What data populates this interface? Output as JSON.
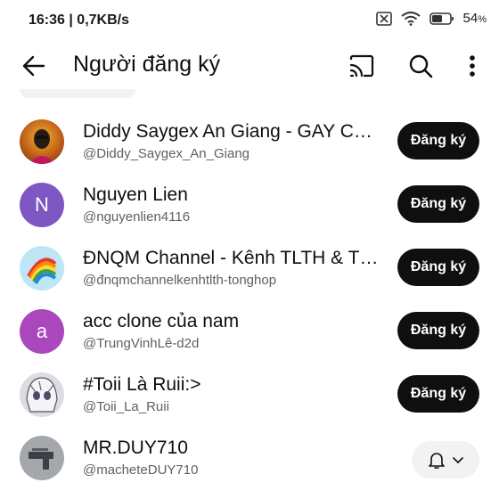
{
  "status_bar": {
    "time": "16:36",
    "speed": "0,7KB/s",
    "battery": "54"
  },
  "header": {
    "title": "Người đăng ký",
    "icons": [
      "back-arrow-icon",
      "cast-icon",
      "search-icon",
      "more-vert-icon"
    ]
  },
  "subscribers": [
    {
      "name": "Diddy Saygex An Giang - GAY Cấp Độ Hỗn Mang",
      "handle": "@Diddy_Saygex_An_Giang",
      "button": "Đăng ký",
      "avatar_color": "#c7751b"
    },
    {
      "name": "Nguyen Lien",
      "handle": "@nguyenlien4116",
      "button": "Đăng ký",
      "avatar_letter": "N",
      "avatar_color": "#7e57c2"
    },
    {
      "name": "ĐNQM Channel - Kênh TLTH & Tổng Hợp",
      "handle": "@đnqmchannelkenhtlth-tonghop",
      "button": "Đăng ký",
      "avatar_color": "#b9e3f5"
    },
    {
      "name": "acc clone của nam",
      "handle": "@TrungVinhLê-d2d",
      "button": "Đăng ký",
      "avatar_letter": "a",
      "avatar_color": "#ab47bc"
    },
    {
      "name": "#Toii Là Ruii:>",
      "handle": "@Toii_La_Ruii",
      "button": "Đăng ký",
      "avatar_color": "#d8d8e0"
    },
    {
      "name": "MR.DUY710",
      "handle": "@macheteDUY710",
      "subscribed": true,
      "avatar_color": "#9aa0a6"
    }
  ]
}
